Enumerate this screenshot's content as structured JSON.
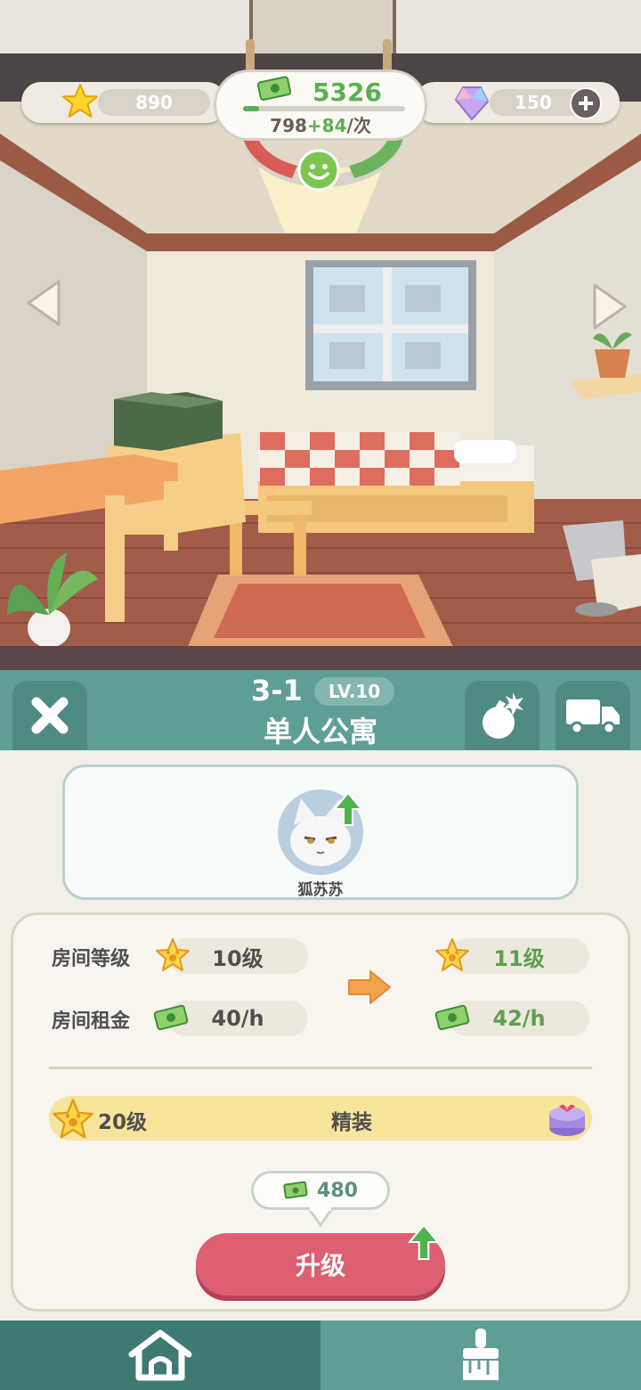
{
  "hud": {
    "stars": "890",
    "money": "5326",
    "money_progress": 0.1,
    "rate_base": "798",
    "rate_bonus": "+84",
    "rate_unit": "/次",
    "gems": "150"
  },
  "room": {
    "number": "3-1",
    "level_badge": "LV.10",
    "name": "单人公寓"
  },
  "tenant": {
    "name": "狐苏苏"
  },
  "stats": {
    "level_label": "房间等级",
    "level_current": "10级",
    "level_next": "11级",
    "rent_label": "房间租金",
    "rent_current": "40/h",
    "rent_next": "42/h"
  },
  "decoration": {
    "level": "20级",
    "name": "精装"
  },
  "upgrade": {
    "cost": "480",
    "label": "升级"
  },
  "colors": {
    "teal": "#5f9e95",
    "green": "#5caf52",
    "upgrade": "#dd5f72"
  },
  "icons": [
    "star-icon",
    "cash-icon",
    "gem-icon",
    "plus-icon",
    "smiley-icon",
    "close-icon",
    "bomb-icon",
    "truck-icon",
    "home-icon",
    "paint-icon",
    "arrow-right-icon",
    "level-up-arrow-icon",
    "gift-icon"
  ]
}
